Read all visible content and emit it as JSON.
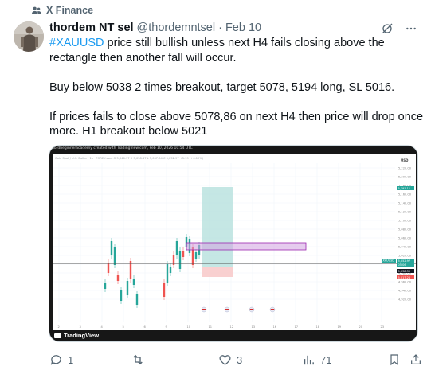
{
  "context": {
    "label": "X Finance",
    "icon": "community-people-icon"
  },
  "tweet": {
    "author_name": "thordem NT sel",
    "handle": "@thordemntsel",
    "separator": "·",
    "date": "Feb 10",
    "hashtag": "#XAUUSD",
    "line1": " price still bullish unless next H4 fails closing  above the rectangle then another fall will occur.",
    "line2": "Buy below 5038 2 times breakout, target 5078, 5194 long, SL 5016.",
    "line3": "If prices fails to close above 5078,86 on next H4 then price will drop once more. H1 breakout below 5021"
  },
  "icons": {
    "grok": "grok-icon",
    "more": "more-options-icon"
  },
  "media": {
    "caption": "nordbeginneracademy created with TradingView.com, Feb 10, 2026 10:54 UTC",
    "symbol_line": "Gold Spot / U.S. Dollar · 1h · FOREX.com   O 5,046.97  H 5,058.37  L 5,037.04  C 5,052.97  +5.99 (+0.12%)",
    "price_axis": {
      "currency": "USD",
      "ticks": [
        "5,220.00",
        "5,200.00",
        "5,180.00",
        "5,160.00",
        "5,140.00",
        "5,120.00",
        "5,100.00",
        "5,080.00",
        "5,060.00",
        "5,040.00",
        "5,020.00",
        "5,000.00",
        "4,980.00",
        "4,960.00",
        "4,940.00",
        "4,920.00"
      ]
    },
    "price_tags": {
      "target": "5,191.11",
      "current_symbol": "XAUUSD",
      "current": "5,052.97",
      "countdown": "05:06",
      "entry": "5,038.39",
      "stop": "5,017.24"
    },
    "time_axis": [
      "2",
      "3",
      "4",
      "5",
      "6",
      "9",
      "10",
      "11",
      "12",
      "13",
      "16",
      "17",
      "18",
      "19",
      "20",
      "23"
    ],
    "brand": "TradingView"
  },
  "actions": {
    "reply": {
      "icon": "reply-icon",
      "count": "1"
    },
    "repost": {
      "icon": "repost-icon",
      "count": ""
    },
    "like": {
      "icon": "like-icon",
      "count": "3"
    },
    "views": {
      "icon": "views-icon",
      "count": "71"
    },
    "bookmark": {
      "icon": "bookmark-icon"
    },
    "share": {
      "icon": "share-icon"
    }
  },
  "colors": {
    "link": "#1d9bf0",
    "muted": "#536471",
    "candle_up": "#26a69a",
    "candle_down": "#ef5350",
    "zone_profit": "#b2dfdb",
    "zone_loss": "#f8c8c8",
    "rectangle": "#9c27b0"
  }
}
